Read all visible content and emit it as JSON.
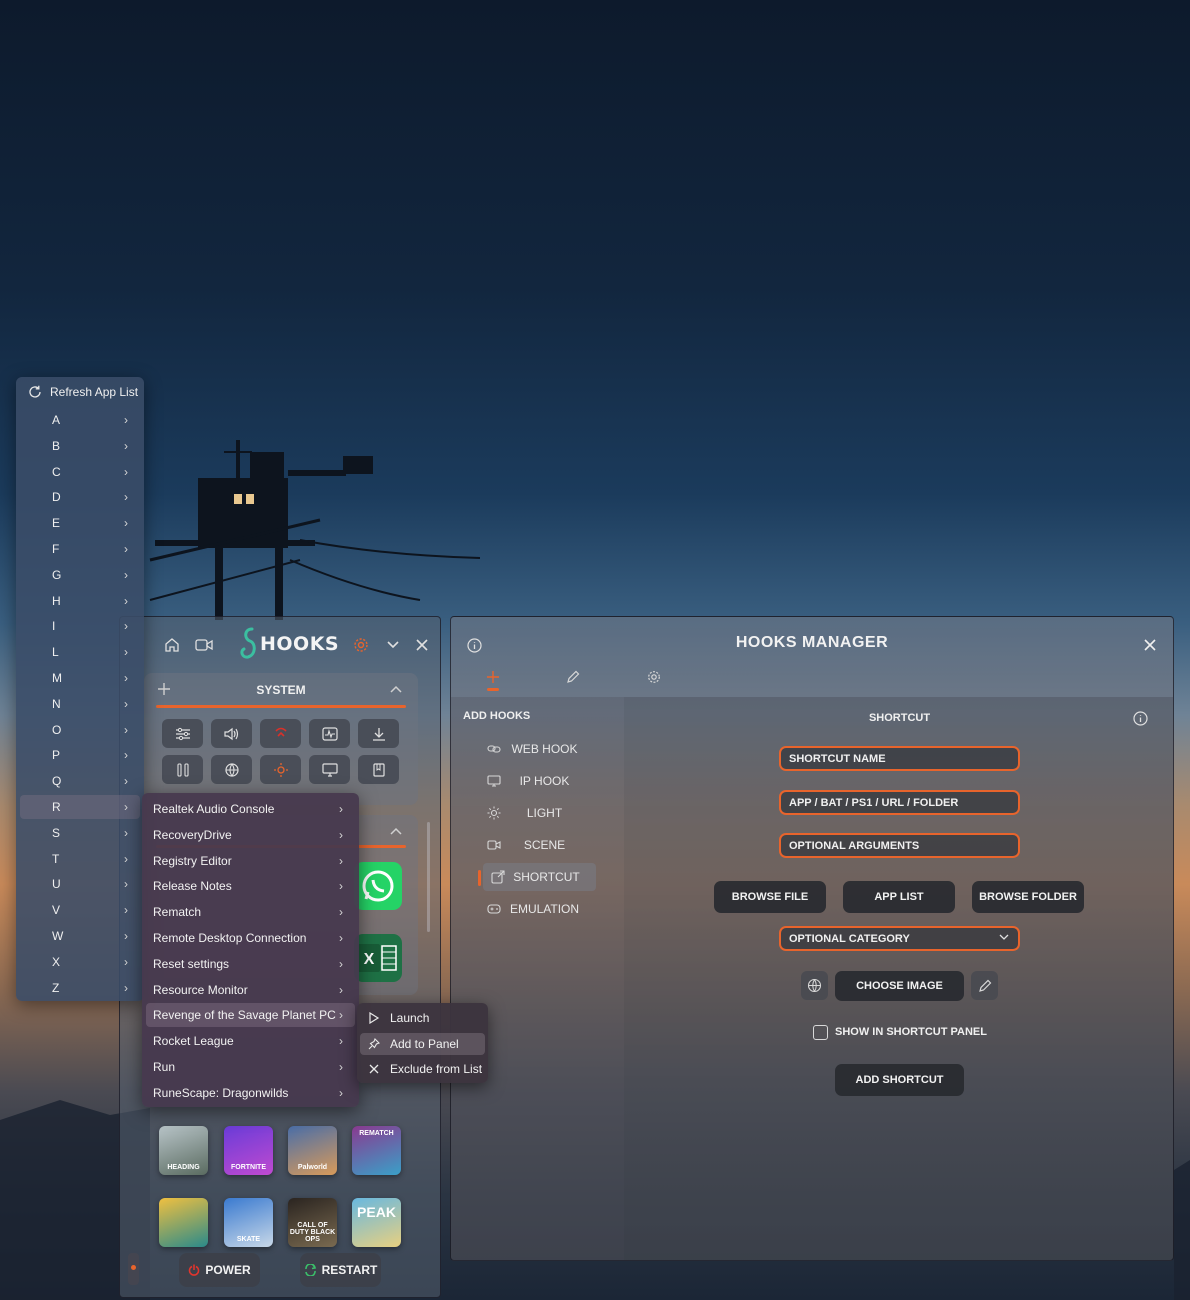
{
  "alpha_menu": {
    "refresh_label": "Refresh App List",
    "letters": [
      "A",
      "B",
      "C",
      "D",
      "E",
      "F",
      "G",
      "H",
      "I",
      "L",
      "M",
      "N",
      "O",
      "P",
      "Q",
      "R",
      "S",
      "T",
      "U",
      "V",
      "W",
      "X",
      "Z"
    ],
    "active_letter": "R"
  },
  "r_submenu": {
    "items": [
      "Realtek Audio Console",
      "RecoveryDrive",
      "Registry Editor",
      "Release Notes",
      "Rematch",
      "Remote Desktop Connection",
      "Reset settings",
      "Resource Monitor",
      "Revenge of the Savage Planet PC",
      "Rocket League",
      "Run",
      "RuneScape: Dragonwilds"
    ],
    "active_item": "Revenge of the Savage Planet PC"
  },
  "context_menu": {
    "launch": "Launch",
    "add_to_panel": "Add to Panel",
    "exclude": "Exclude from List"
  },
  "hooks_panel": {
    "logo_text": "HOOKS",
    "system_title": "SYSTEM",
    "game_tiles": [
      "HEADING",
      "FORTNITE",
      "Palworld",
      "REMATCH",
      "",
      "SKATE",
      "CALL OF DUTY BLACK OPS",
      "PEAK"
    ],
    "power_label": "POWER",
    "restart_label": "RESTART"
  },
  "manager": {
    "title": "HOOKS MANAGER",
    "add_hooks_label": "ADD HOOKS",
    "nav": [
      "WEB HOOK",
      "IP HOOK",
      "LIGHT",
      "SCENE",
      "SHORTCUT",
      "EMULATION"
    ],
    "active_nav": "SHORTCUT",
    "shortcut": {
      "title": "SHORTCUT",
      "name_field": "SHORTCUT NAME",
      "path_field": "APP / BAT / PS1 / URL / FOLDER",
      "args_field": "OPTIONAL ARGUMENTS",
      "browse_file": "BROWSE FILE",
      "app_list": "APP LIST",
      "browse_folder": "BROWSE FOLDER",
      "category": "OPTIONAL CATEGORY",
      "choose_image": "CHOOSE IMAGE",
      "show_in_panel": "SHOW IN SHORTCUT PANEL",
      "add_shortcut": "ADD SHORTCUT"
    }
  },
  "colors": {
    "accent": "#e8642c",
    "whatsapp": "#25d366",
    "excel": "#1e7145"
  }
}
